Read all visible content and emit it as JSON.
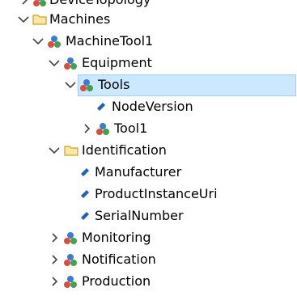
{
  "colors": {
    "selection_bg": "#cce8ff",
    "selection_border": "#99d1ff",
    "folder": "#e8c24a",
    "object_red": "#e04b3a",
    "object_green": "#3fa34d",
    "object_blue": "#3a7bd5",
    "variable_blue": "#1f5fbf"
  },
  "tree": {
    "items": [
      {
        "label": "DeviceTopology",
        "icon": "object-icon",
        "expander": "collapsed"
      },
      {
        "label": "Machines",
        "icon": "folder-icon",
        "expander": "expanded"
      },
      {
        "label": "MachineTool1",
        "icon": "object-icon",
        "expander": "expanded"
      },
      {
        "label": "Equipment",
        "icon": "object-icon",
        "expander": "expanded"
      },
      {
        "label": "Tools",
        "icon": "object-icon",
        "expander": "expanded",
        "selected": true
      },
      {
        "label": "NodeVersion",
        "icon": "variable-icon",
        "expander": "none"
      },
      {
        "label": "Tool1",
        "icon": "object-icon",
        "expander": "collapsed"
      },
      {
        "label": "Identification",
        "icon": "folder-icon",
        "expander": "expanded"
      },
      {
        "label": "Manufacturer",
        "icon": "variable-icon",
        "expander": "none"
      },
      {
        "label": "ProductInstanceUri",
        "icon": "variable-icon",
        "expander": "none"
      },
      {
        "label": "SerialNumber",
        "icon": "variable-icon",
        "expander": "none"
      },
      {
        "label": "Monitoring",
        "icon": "object-icon",
        "expander": "collapsed"
      },
      {
        "label": "Notification",
        "icon": "object-icon",
        "expander": "collapsed"
      },
      {
        "label": "Production",
        "icon": "object-icon",
        "expander": "collapsed"
      }
    ]
  }
}
